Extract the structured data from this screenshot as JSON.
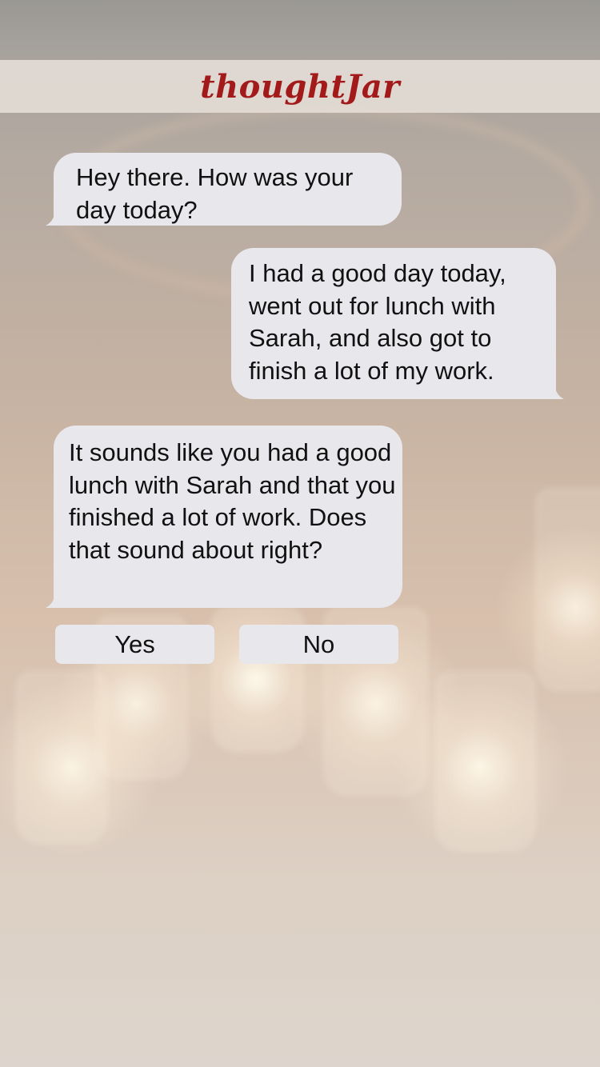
{
  "app": {
    "title": "thoughtJar"
  },
  "messages": [
    {
      "sender": "bot",
      "text": "Hey there. How was your day today?"
    },
    {
      "sender": "user",
      "text": "I had a good day today, went out for lunch with Sarah, and also got to finish a lot of my work."
    },
    {
      "sender": "bot",
      "text": "It sounds like you had a good lunch with Sarah and that you finished a lot of work. Does that sound about right?"
    }
  ],
  "quick_replies": {
    "yes_label": "Yes",
    "no_label": "No"
  },
  "colors": {
    "brand": "#a31a1a",
    "bubble": "#e8e7ec",
    "header": "#e1dad4"
  }
}
